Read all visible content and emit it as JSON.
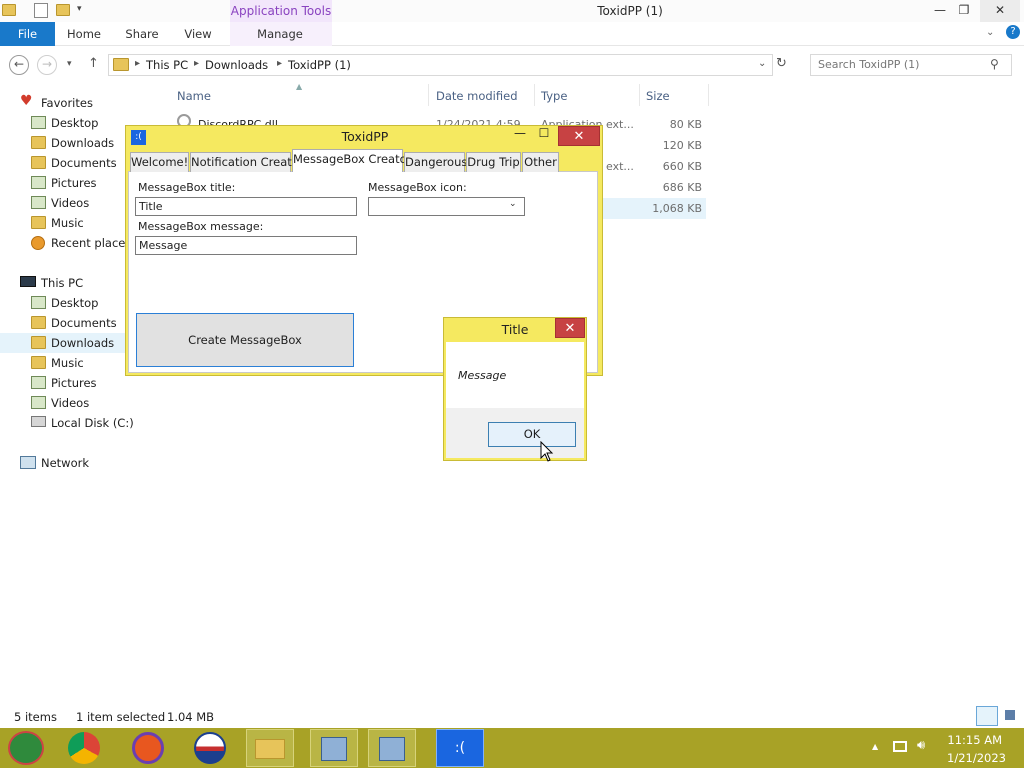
{
  "explorer": {
    "window_title": "ToxidPP (1)",
    "context_tab": "Application Tools",
    "caption": {
      "minimize": "—",
      "maximize": "❐",
      "close": "✕"
    },
    "ribbon_tabs": [
      "File",
      "Home",
      "Share",
      "View",
      "Manage"
    ],
    "breadcrumb": [
      "This PC",
      "Downloads",
      "ToxidPP (1)"
    ],
    "search_placeholder": "Search ToxidPP (1)",
    "nav": {
      "favorites_label": "Favorites",
      "favorites": [
        "Desktop",
        "Downloads",
        "Documents",
        "Pictures",
        "Videos",
        "Music",
        "Recent places"
      ],
      "thispc_label": "This PC",
      "thispc": [
        "Desktop",
        "Documents",
        "Downloads",
        "Music",
        "Pictures",
        "Videos",
        "Local Disk (C:)"
      ],
      "network_label": "Network",
      "selected": "Downloads"
    },
    "columns": {
      "name": "Name",
      "date": "Date modified",
      "type": "Type",
      "size": "Size"
    },
    "files": [
      {
        "name": "DiscordRPC.dll",
        "date": "1/24/2021 4:59",
        "type": "Application ext...",
        "size": "80 KB"
      },
      {
        "name": "",
        "date": "",
        "type": "",
        "size": "120 KB"
      },
      {
        "name": "",
        "date": "",
        "type": "ext...",
        "size": "660 KB"
      },
      {
        "name": "",
        "date": "",
        "type": "",
        "size": "686 KB"
      },
      {
        "name": "",
        "date": "",
        "type": "",
        "size": "1,068 KB"
      }
    ],
    "status": {
      "items": "5 items",
      "selected": "1 item selected",
      "size": "1.04 MB"
    }
  },
  "toxid": {
    "title": "ToxidPP",
    "icon_text": ":(",
    "caption": {
      "minimize": "—",
      "maximize": "☐",
      "close": "✕"
    },
    "tabs": [
      "Welcome!",
      "Notification Creator",
      "MessageBox Creator",
      "Dangerous",
      "Drug Trip",
      "Other"
    ],
    "active_tab": "MessageBox Creator",
    "title_label": "MessageBox title:",
    "title_value": "Title",
    "message_label": "MessageBox message:",
    "message_value": "Message",
    "icon_label": "MessageBox icon:",
    "icon_value": "",
    "create_button": "Create MessageBox"
  },
  "messagebox": {
    "title": "Title",
    "close": "✕",
    "message": "Message",
    "ok": "OK"
  },
  "taskbar": {
    "time": "11:15 AM",
    "date": "1/21/2023",
    "apps": [
      "start-icon",
      "chrome-icon",
      "firefox-icon",
      "obama-icon",
      "file-explorer-icon",
      "installer-icon",
      "installer-icon",
      "toxidpp-icon"
    ]
  },
  "colors": {
    "file_tab": "#1979ca",
    "context_tab": "#8a43c0",
    "window_frame": "#f5e960",
    "close_red": "#c74243",
    "taskbar": "#a8a226"
  }
}
